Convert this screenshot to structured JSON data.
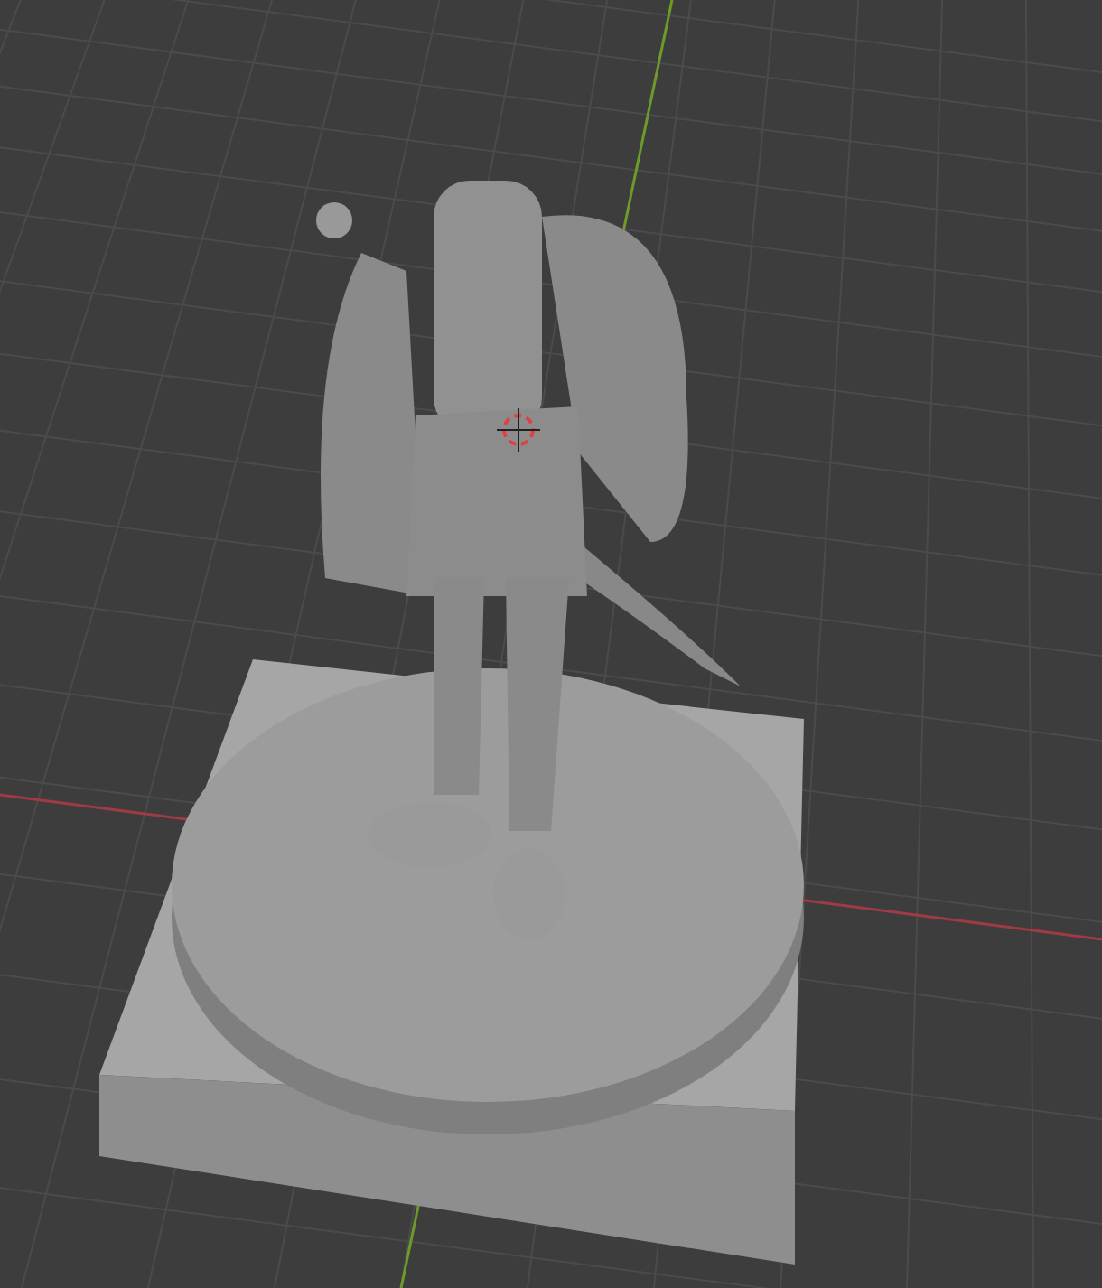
{
  "viewport": {
    "grid_visible": true,
    "x_axis_visible": true,
    "y_axis_visible": true,
    "cursor_visible": true
  }
}
